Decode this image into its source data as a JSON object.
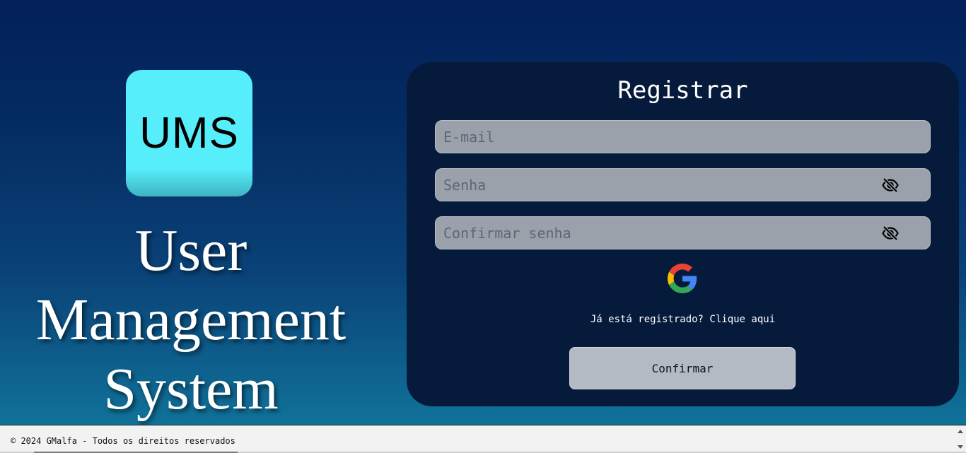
{
  "brand": {
    "logo_text": "UMS",
    "title_lines": [
      "User",
      "Management",
      "System"
    ]
  },
  "register_form": {
    "title": "Registrar",
    "email_placeholder": "E-mail",
    "password_placeholder": "Senha",
    "confirm_password_placeholder": "Confirmar senha",
    "login_link": "Já está registrado? Clique aqui",
    "confirm_button": "Confirmar",
    "icons": {
      "password_toggle": "eye-off-icon",
      "confirm_password_toggle": "eye-off-icon",
      "google_sign_in": "google-icon"
    }
  },
  "footer": {
    "copyright": "© 2024 GMalfa - Todos os direitos reservados"
  },
  "colors": {
    "background_top": "#03205a",
    "background_bottom": "#117ba0",
    "logo_accent": "#55eefa",
    "card_background": "#061b3c",
    "input_background": "#9ba1ab",
    "button_background": "#b4bac4"
  }
}
